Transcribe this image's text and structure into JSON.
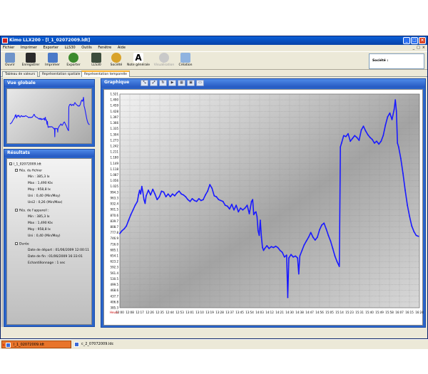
{
  "window": {
    "title": "Kimo LLX200 - [l_1_02072009.ldt]",
    "min_glyph": "_",
    "max_glyph": "□",
    "close_glyph": "×"
  },
  "menu": {
    "items": [
      "Fichier",
      "Imprimer",
      "Exporter",
      "LLS30",
      "Outils",
      "Fenêtre",
      "Aide"
    ],
    "mdi_buttons": [
      "_",
      "□",
      "×"
    ]
  },
  "toolbar": {
    "buttons": [
      {
        "label": "Ouvrir",
        "icon": "open-folder-icon",
        "color": "#6f94c9"
      },
      {
        "label": "Enregistrer",
        "icon": "save-icon",
        "color": "#2b2b2b"
      },
      {
        "label": "Imprimer",
        "icon": "printer-icon",
        "color": "#4a79c8"
      },
      {
        "label": "Exporter",
        "icon": "export-icon",
        "color": "#3b8a2d"
      },
      {
        "label": "LLS30",
        "icon": "device-icon",
        "color": "#3d4d3d"
      },
      {
        "label": "Société",
        "icon": "company-icon",
        "color": "#d9a32a"
      },
      {
        "label": "Note générale",
        "icon": "note-icon",
        "color": "#ffffff"
      },
      {
        "label": "Visualisation",
        "icon": "visualisation-icon",
        "color": "#c9c9c9"
      },
      {
        "label": "Création",
        "icon": "creation-icon",
        "color": "#8fb3e0"
      }
    ],
    "note_glyph": "A",
    "societe_label": "Société :"
  },
  "tabs": [
    {
      "label": "Tableau de valeurs",
      "active": false
    },
    {
      "label": "Représentation spatiale",
      "active": false
    },
    {
      "label": "Représentation temporelle",
      "active": true
    }
  ],
  "vue_globale": {
    "title": "Vue globale"
  },
  "resultats": {
    "title": "Résultats",
    "tree": {
      "file": "l_1_02072009.ldt",
      "fichier_group": "Rés. du fichier",
      "fichier_items": [
        "Min : 385,3 lx",
        "Max : 1,490 Klx",
        "Moy : 958,8 lx",
        "Uni : 0,40 (Min/Moy)",
        "Uni2 : 0,26 (Min/Max)"
      ],
      "appareil_group": "Rés. de l'appareil :",
      "appareil_items": [
        "Min : 385,3 lx",
        "Max : 1,490 Klx",
        "Moy : 958,8 lx",
        "Uni : 0,40 (Min/Moy)"
      ],
      "duree_group": "Durée",
      "duree_items": [
        "Date de départ : 01/06/2009 12:00:11",
        "Date de fin : 01/06/2009 16:33:01",
        "Echantillonnage : 1 sec"
      ]
    },
    "expander_glyph": "-"
  },
  "graphique": {
    "title": "Graphique",
    "tools": [
      "⤡",
      "⤢",
      "↻",
      "▶",
      "▦",
      "▣",
      "▭"
    ]
  },
  "chart_data": {
    "type": "line",
    "color": "#1a1aff",
    "y_ticks": [
      "1.521",
      "1.490",
      "1.459",
      "1.428",
      "1.397",
      "1.366",
      "1.335",
      "1.304",
      "1.273",
      "1.242",
      "1.211",
      "1.180",
      "1.149",
      "1.118",
      "1.087",
      "1.056",
      "1.025",
      "994.3",
      "963.3",
      "932.4",
      "901.5",
      "870.6",
      "839.7",
      "808.7",
      "777.8",
      "746.9",
      "716.0",
      "685.1",
      "654.1",
      "623.2",
      "592.3",
      "561.4",
      "530.5",
      "499.5",
      "468.6",
      "437.7",
      "406.8",
      "385.3"
    ],
    "x_unit_label": "Heure",
    "x_ticks": [
      "12:00",
      "12:08",
      "12:17",
      "12:26",
      "12:35",
      "12:44",
      "12:53",
      "13:01",
      "13:10",
      "13:19",
      "13:28",
      "13:37",
      "13:45",
      "13:54",
      "14:03",
      "14:12",
      "14:21",
      "14:30",
      "14:38",
      "14:47",
      "14:56",
      "15:05",
      "15:14",
      "15:23",
      "15:31",
      "15:40",
      "15:49",
      "15:58",
      "16:07",
      "16:15",
      "16:24"
    ],
    "ylim": [
      385.3,
      1521
    ],
    "xlim_minutes": [
      0,
      273
    ],
    "points": [
      [
        0,
        780
      ],
      [
        2,
        795
      ],
      [
        4,
        805
      ],
      [
        6,
        820
      ],
      [
        8,
        850
      ],
      [
        10,
        880
      ],
      [
        12,
        905
      ],
      [
        14,
        930
      ],
      [
        16,
        950
      ],
      [
        17,
        985
      ],
      [
        18,
        1010
      ],
      [
        19,
        990
      ],
      [
        20,
        1030
      ],
      [
        21,
        1000
      ],
      [
        22,
        960
      ],
      [
        23,
        940
      ],
      [
        24,
        980
      ],
      [
        26,
        1010
      ],
      [
        28,
        985
      ],
      [
        30,
        1015
      ],
      [
        32,
        990
      ],
      [
        34,
        960
      ],
      [
        36,
        975
      ],
      [
        38,
        1005
      ],
      [
        40,
        1000
      ],
      [
        42,
        975
      ],
      [
        44,
        990
      ],
      [
        46,
        975
      ],
      [
        48,
        990
      ],
      [
        50,
        980
      ],
      [
        52,
        995
      ],
      [
        54,
        1005
      ],
      [
        56,
        990
      ],
      [
        58,
        985
      ],
      [
        60,
        975
      ],
      [
        62,
        960
      ],
      [
        64,
        950
      ],
      [
        66,
        965
      ],
      [
        68,
        955
      ],
      [
        70,
        950
      ],
      [
        72,
        965
      ],
      [
        74,
        955
      ],
      [
        76,
        960
      ],
      [
        78,
        985
      ],
      [
        80,
        1005
      ],
      [
        82,
        1040
      ],
      [
        84,
        1020
      ],
      [
        86,
        980
      ],
      [
        88,
        975
      ],
      [
        90,
        960
      ],
      [
        92,
        955
      ],
      [
        94,
        950
      ],
      [
        96,
        930
      ],
      [
        98,
        925
      ],
      [
        100,
        910
      ],
      [
        102,
        935
      ],
      [
        104,
        905
      ],
      [
        106,
        930
      ],
      [
        108,
        895
      ],
      [
        110,
        915
      ],
      [
        112,
        905
      ],
      [
        114,
        915
      ],
      [
        116,
        930
      ],
      [
        118,
        885
      ],
      [
        120,
        950
      ],
      [
        121,
        960
      ],
      [
        122,
        880
      ],
      [
        123,
        890
      ],
      [
        124,
        895
      ],
      [
        125,
        870
      ],
      [
        126,
        795
      ],
      [
        127,
        770
      ],
      [
        128,
        850
      ],
      [
        129,
        760
      ],
      [
        130,
        705
      ],
      [
        131,
        690
      ],
      [
        132,
        700
      ],
      [
        134,
        715
      ],
      [
        136,
        700
      ],
      [
        138,
        710
      ],
      [
        140,
        705
      ],
      [
        142,
        712
      ],
      [
        144,
        705
      ],
      [
        146,
        690
      ],
      [
        148,
        680
      ],
      [
        150,
        655
      ],
      [
        152,
        665
      ],
      [
        153,
        440
      ],
      [
        154,
        650
      ],
      [
        156,
        668
      ],
      [
        158,
        655
      ],
      [
        160,
        660
      ],
      [
        162,
        650
      ],
      [
        163,
        565
      ],
      [
        164,
        660
      ],
      [
        166,
        690
      ],
      [
        168,
        720
      ],
      [
        170,
        740
      ],
      [
        172,
        760
      ],
      [
        174,
        785
      ],
      [
        176,
        760
      ],
      [
        178,
        745
      ],
      [
        180,
        760
      ],
      [
        182,
        800
      ],
      [
        184,
        825
      ],
      [
        186,
        835
      ],
      [
        188,
        805
      ],
      [
        190,
        770
      ],
      [
        192,
        740
      ],
      [
        194,
        700
      ],
      [
        196,
        660
      ],
      [
        198,
        630
      ],
      [
        200,
        605
      ],
      [
        201,
        1240
      ],
      [
        202,
        1260
      ],
      [
        204,
        1300
      ],
      [
        206,
        1295
      ],
      [
        208,
        1310
      ],
      [
        210,
        1270
      ],
      [
        212,
        1285
      ],
      [
        214,
        1300
      ],
      [
        216,
        1290
      ],
      [
        218,
        1275
      ],
      [
        220,
        1330
      ],
      [
        222,
        1350
      ],
      [
        224,
        1325
      ],
      [
        226,
        1305
      ],
      [
        228,
        1290
      ],
      [
        230,
        1280
      ],
      [
        232,
        1260
      ],
      [
        234,
        1270
      ],
      [
        236,
        1255
      ],
      [
        238,
        1270
      ],
      [
        240,
        1300
      ],
      [
        242,
        1355
      ],
      [
        244,
        1400
      ],
      [
        246,
        1420
      ],
      [
        248,
        1385
      ],
      [
        250,
        1440
      ],
      [
        251,
        1490
      ],
      [
        252,
        1430
      ],
      [
        253,
        1260
      ],
      [
        254,
        1240
      ],
      [
        256,
        1180
      ],
      [
        258,
        1100
      ],
      [
        260,
        1010
      ],
      [
        262,
        930
      ],
      [
        264,
        870
      ],
      [
        266,
        820
      ],
      [
        268,
        790
      ],
      [
        270,
        770
      ],
      [
        272,
        765
      ]
    ]
  },
  "taskbar": {
    "tasks": [
      {
        "label": "l_1_02072009.ldt",
        "active": true
      },
      {
        "label": "c_2_07072009.ldc",
        "active": false
      }
    ],
    "close_glyph": "×"
  }
}
